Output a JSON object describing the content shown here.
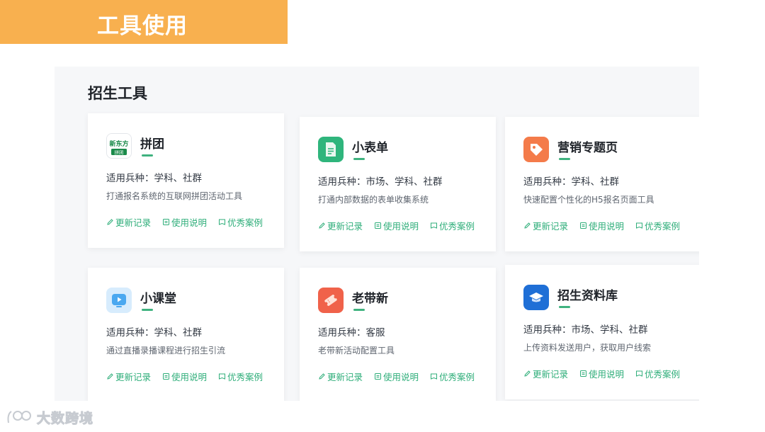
{
  "banner": {
    "title": "工具使用"
  },
  "panel": {
    "title": "招生工具"
  },
  "link_labels": {
    "changelog": "更新记录",
    "manual": "使用说明",
    "cases": "优秀案例"
  },
  "cards": [
    {
      "name": "拼团",
      "scope": "适用兵种：学科、社群",
      "desc": "打通报名系统的互联网拼团活动工具",
      "icon": "xdf-logo-icon",
      "icon_text_top": "新东方",
      "icon_text_bottom": "拼团",
      "color": "#1a8a4a"
    },
    {
      "name": "小表单",
      "scope": "适用兵种：市场、学科、社群",
      "desc": "打通内部数据的表单收集系统",
      "icon": "document-icon",
      "color": "#2fb57c"
    },
    {
      "name": "营销专题页",
      "scope": "适用兵种：学科、社群",
      "desc": "快速配置个性化的H5报名页面工具",
      "icon": "tag-icon",
      "color": "#f47b4a"
    },
    {
      "name": "小课堂",
      "scope": "适用兵种：学科、社群",
      "desc": "通过直播录播课程进行招生引流",
      "icon": "video-play-icon",
      "color": "#4aa8f0"
    },
    {
      "name": "老带新",
      "scope": "适用兵种：客服",
      "desc": "老带新活动配置工具",
      "icon": "ticket-icon",
      "color": "#f0624a"
    },
    {
      "name": "招生资料库",
      "scope": "适用兵种：市场、学科、社群",
      "desc": "上传资料发送用户，获取用户线索",
      "icon": "graduation-cap-icon",
      "color": "#1f6fd6"
    }
  ],
  "footer": {
    "brand": "大数跨境",
    "icon": "brand-logo-icon"
  }
}
